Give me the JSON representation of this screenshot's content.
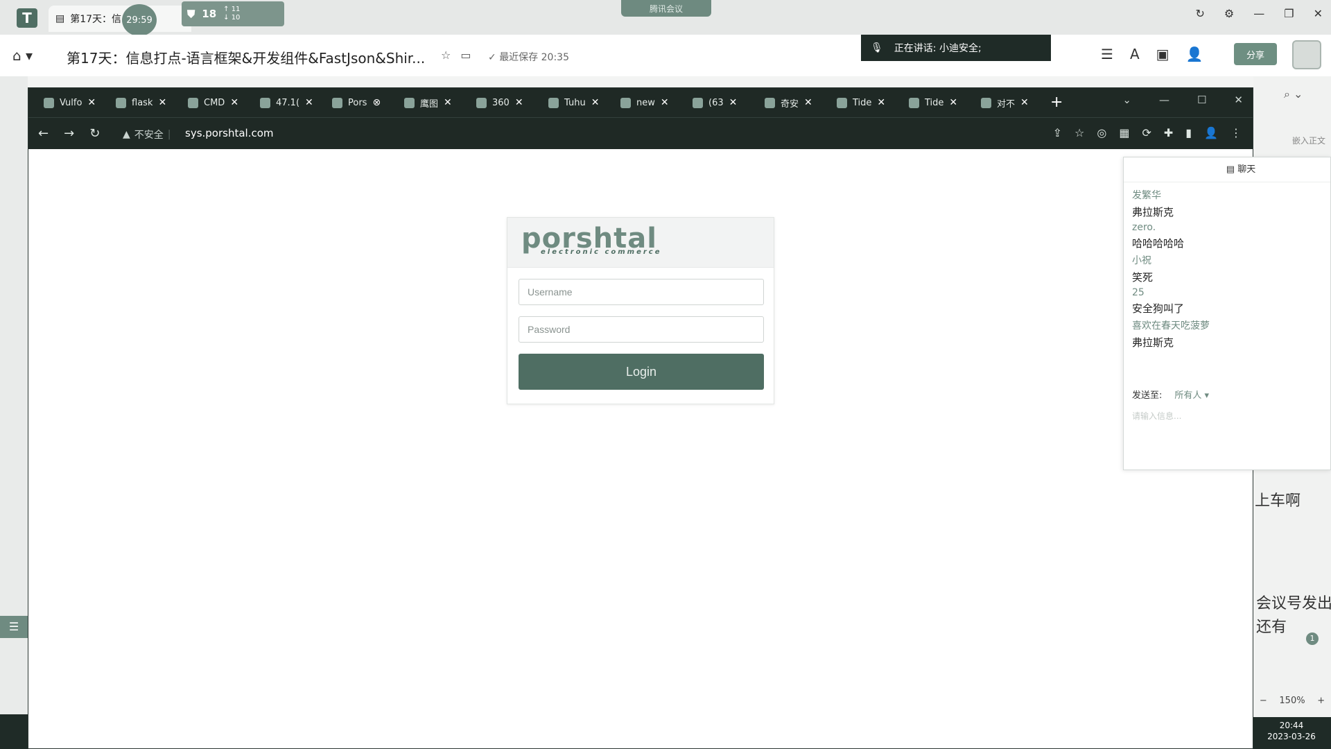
{
  "app": {
    "tab_title": "第17天：信息打点-语言框架&开发组件&FastJson&Shiro...",
    "tab_short": "第17天：信",
    "timer": "29:59",
    "net_value": "18",
    "net_up": "↑ 11",
    "net_down": "↓ 10",
    "meeting_label": "腾讯会议",
    "doc_title": "第17天：信息打点-语言框架&开发组件&FastJson&Shir...",
    "saved_status": "最近保存 20:35",
    "speaking": "正在讲话: 小迪安全;",
    "share_label": "分享",
    "embed_label": "嵌入正文",
    "zoom": "150%",
    "clock_time": "20:44",
    "clock_date": "2023-03-26",
    "bg_text_1": "上车啊",
    "bg_text_2": "会议号发出",
    "bg_text_3": "还有",
    "badge_count": "1"
  },
  "browser": {
    "tabs": [
      {
        "label": "Vulfo"
      },
      {
        "label": "flask"
      },
      {
        "label": "CMD"
      },
      {
        "label": "47.1("
      },
      {
        "label": "Pors"
      },
      {
        "label": "鹰图"
      },
      {
        "label": "360"
      },
      {
        "label": "Tuhu"
      },
      {
        "label": "new"
      },
      {
        "label": "(63"
      },
      {
        "label": "奇安"
      },
      {
        "label": "Tide"
      },
      {
        "label": "Tide"
      },
      {
        "label": "对不"
      }
    ],
    "insecure_label": "不安全",
    "url": "sys.porshtal.com"
  },
  "login": {
    "brand": "porshtal",
    "brand_sub": "electronic commerce",
    "username_placeholder": "Username",
    "password_placeholder": "Password",
    "button": "Login"
  },
  "chat": {
    "title": "聊天",
    "messages": [
      {
        "name": "发繁华",
        "text": "弗拉斯克"
      },
      {
        "name": "zero.",
        "text": "哈哈哈哈哈"
      },
      {
        "name": "小祝",
        "text": "笑死"
      },
      {
        "name": "25",
        "text": "安全狗叫了"
      },
      {
        "name": "喜欢在春天吃菠萝",
        "text": "弗拉斯克"
      }
    ],
    "send_to_label": "发送至:",
    "send_to_value": "所有人 ▾",
    "input_placeholder": "请输入信息..."
  }
}
